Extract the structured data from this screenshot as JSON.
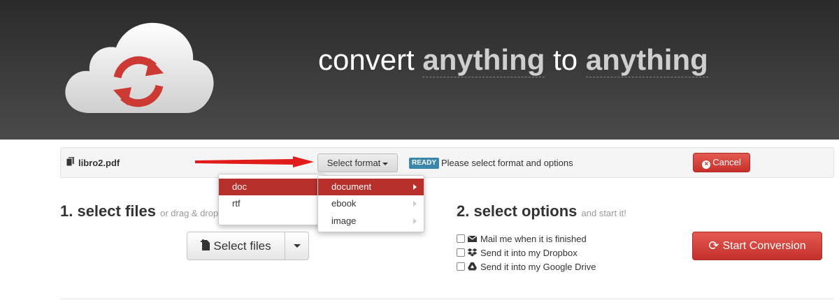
{
  "header": {
    "tagline_parts": [
      "convert",
      "anything",
      "to",
      "anything"
    ]
  },
  "file_row": {
    "file_name": "libro2.pdf",
    "select_format_label": "Select format",
    "status_badge": "READY",
    "status_text": "Please select format and options",
    "cancel_label": "Cancel"
  },
  "format_menu": {
    "formats": [
      "doc",
      "rtf"
    ],
    "selected_format": "doc",
    "categories": [
      "document",
      "ebook",
      "image"
    ],
    "selected_category": "document"
  },
  "section1": {
    "title": "1. select files",
    "subtitle": "or drag & drop them on this page!",
    "select_files_label": "Select files"
  },
  "section2": {
    "title": "2. select options",
    "subtitle": "and start it!",
    "options": [
      "Mail me when it is finished",
      "Send it into my Dropbox",
      "Send it into my Google Drive"
    ],
    "start_label": "Start Conversion"
  },
  "colors": {
    "header_bg": "#333333",
    "accent_red": "#c8302a",
    "ready_badge": "#3a87ad"
  }
}
